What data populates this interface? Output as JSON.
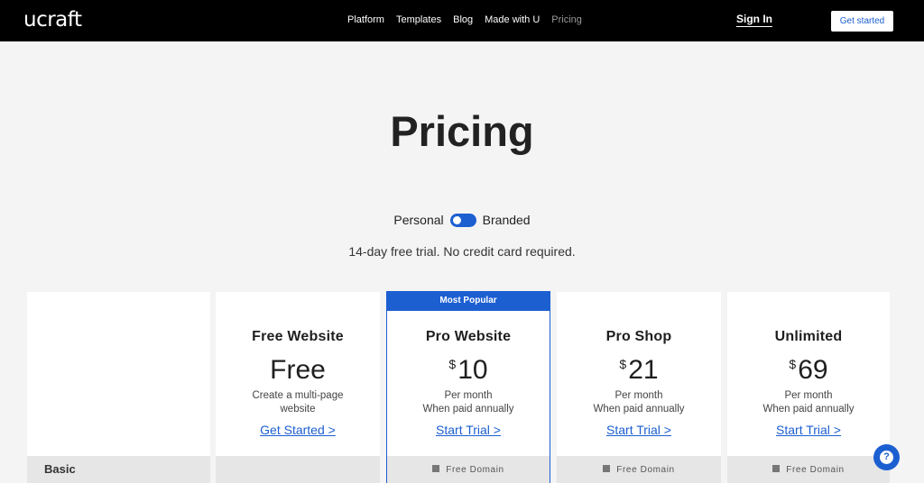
{
  "header": {
    "logo": "ucraft",
    "nav": [
      {
        "label": "Platform"
      },
      {
        "label": "Templates"
      },
      {
        "label": "Blog"
      },
      {
        "label": "Made with U"
      },
      {
        "label": "Pricing"
      }
    ],
    "sign_in": "Sign In",
    "get_started": "Get started"
  },
  "hero": {
    "title": "Pricing",
    "toggle_left": "Personal",
    "toggle_right": "Branded",
    "trial_text": "14-day free trial. No credit card required."
  },
  "plans": [
    {
      "name": "Free Website",
      "price": "Free",
      "currency": "",
      "desc1": "Create a multi-page",
      "desc2": "website",
      "cta": "Get Started >",
      "feature": ""
    },
    {
      "name": "Pro Website",
      "price": "10",
      "currency": "$",
      "desc1": "Per month",
      "desc2": "When paid annually",
      "cta": "Start Trial >",
      "feature": "Free Domain",
      "badge": "Most Popular"
    },
    {
      "name": "Pro Shop",
      "price": "21",
      "currency": "$",
      "desc1": "Per month",
      "desc2": "When paid annually",
      "cta": "Start Trial >",
      "feature": "Free Domain"
    },
    {
      "name": "Unlimited",
      "price": "69",
      "currency": "$",
      "desc1": "Per month",
      "desc2": "When paid annually",
      "cta": "Start Trial >",
      "feature": "Free Domain"
    }
  ],
  "features_section": {
    "label": "Basic"
  },
  "help": {
    "icon": "question-icon",
    "glyph": "?"
  },
  "colors": {
    "accent": "#1c5fd1",
    "header_bg": "#000000",
    "page_bg": "#f4f4f4"
  }
}
